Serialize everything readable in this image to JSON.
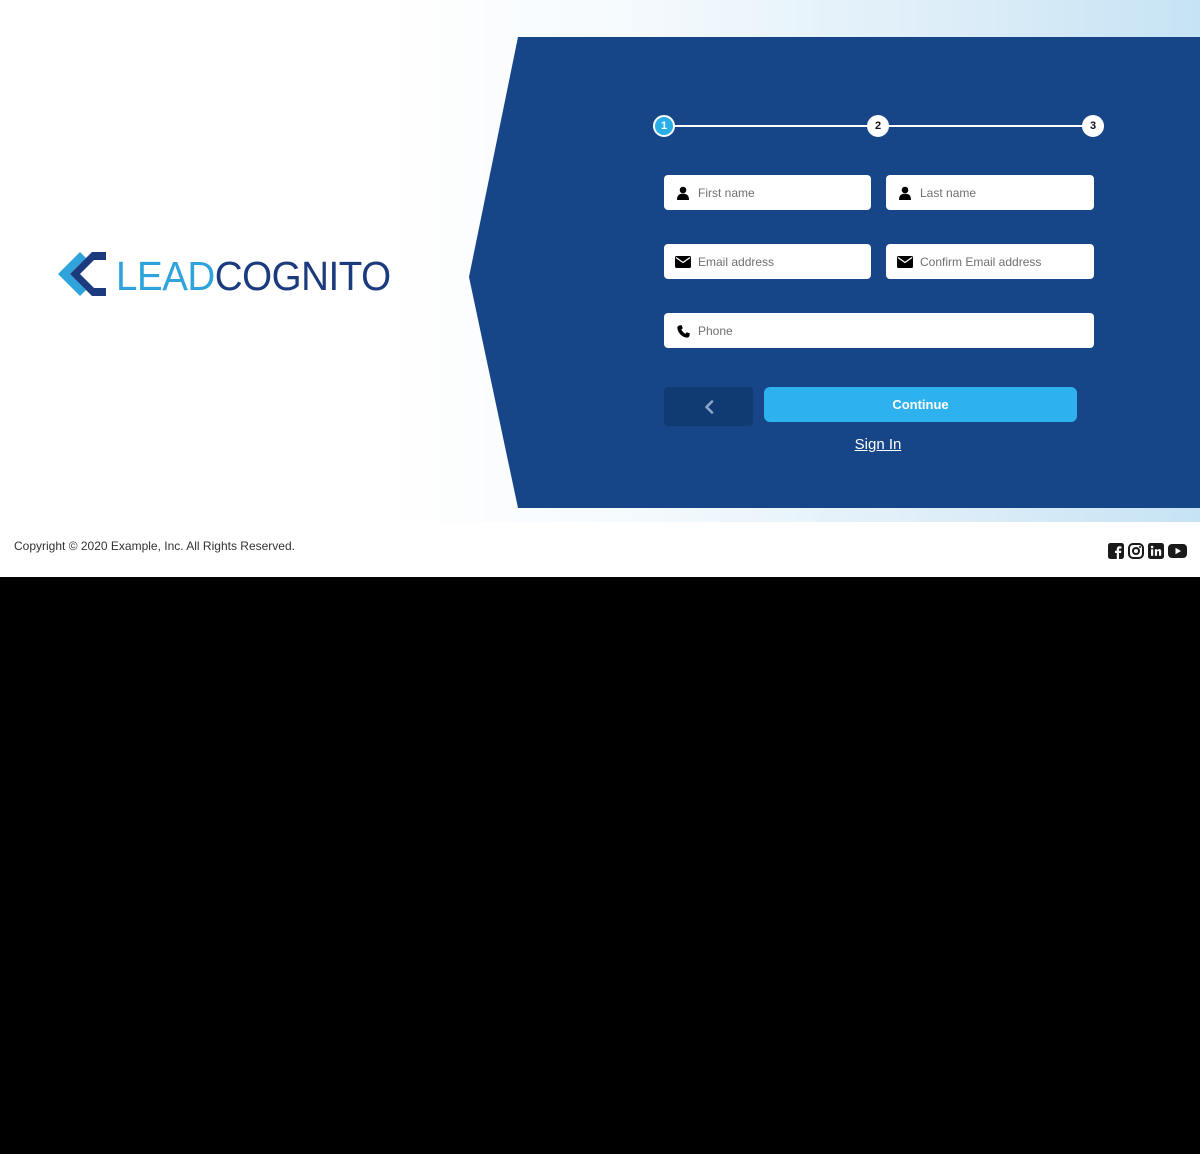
{
  "brand": {
    "logo_part1": "LEAD",
    "logo_part2": "COGNITO",
    "colors": {
      "panel": "#164687",
      "accent": "#2db1ef",
      "logo_light": "#2fa4dc",
      "logo_dark": "#1b3b7e"
    }
  },
  "stepper": {
    "steps": [
      "1",
      "2",
      "3"
    ],
    "active_step": 1
  },
  "form": {
    "first_name": {
      "placeholder": "First name",
      "icon": "user-icon"
    },
    "last_name": {
      "placeholder": "Last name",
      "icon": "user-icon"
    },
    "email": {
      "placeholder": "Email address",
      "icon": "envelope-icon"
    },
    "confirm_email": {
      "placeholder": "Confirm Email address",
      "icon": "envelope-icon"
    },
    "phone": {
      "placeholder": "Phone",
      "icon": "phone-icon"
    },
    "back_icon": "chevron-left-icon",
    "continue_label": "Continue",
    "signin_label": "Sign In"
  },
  "footer": {
    "copyright": "Copyright © 2020 Example, Inc. All Rights Reserved.",
    "social_icons": [
      "facebook-icon",
      "instagram-icon",
      "linkedin-icon",
      "youtube-icon"
    ]
  }
}
